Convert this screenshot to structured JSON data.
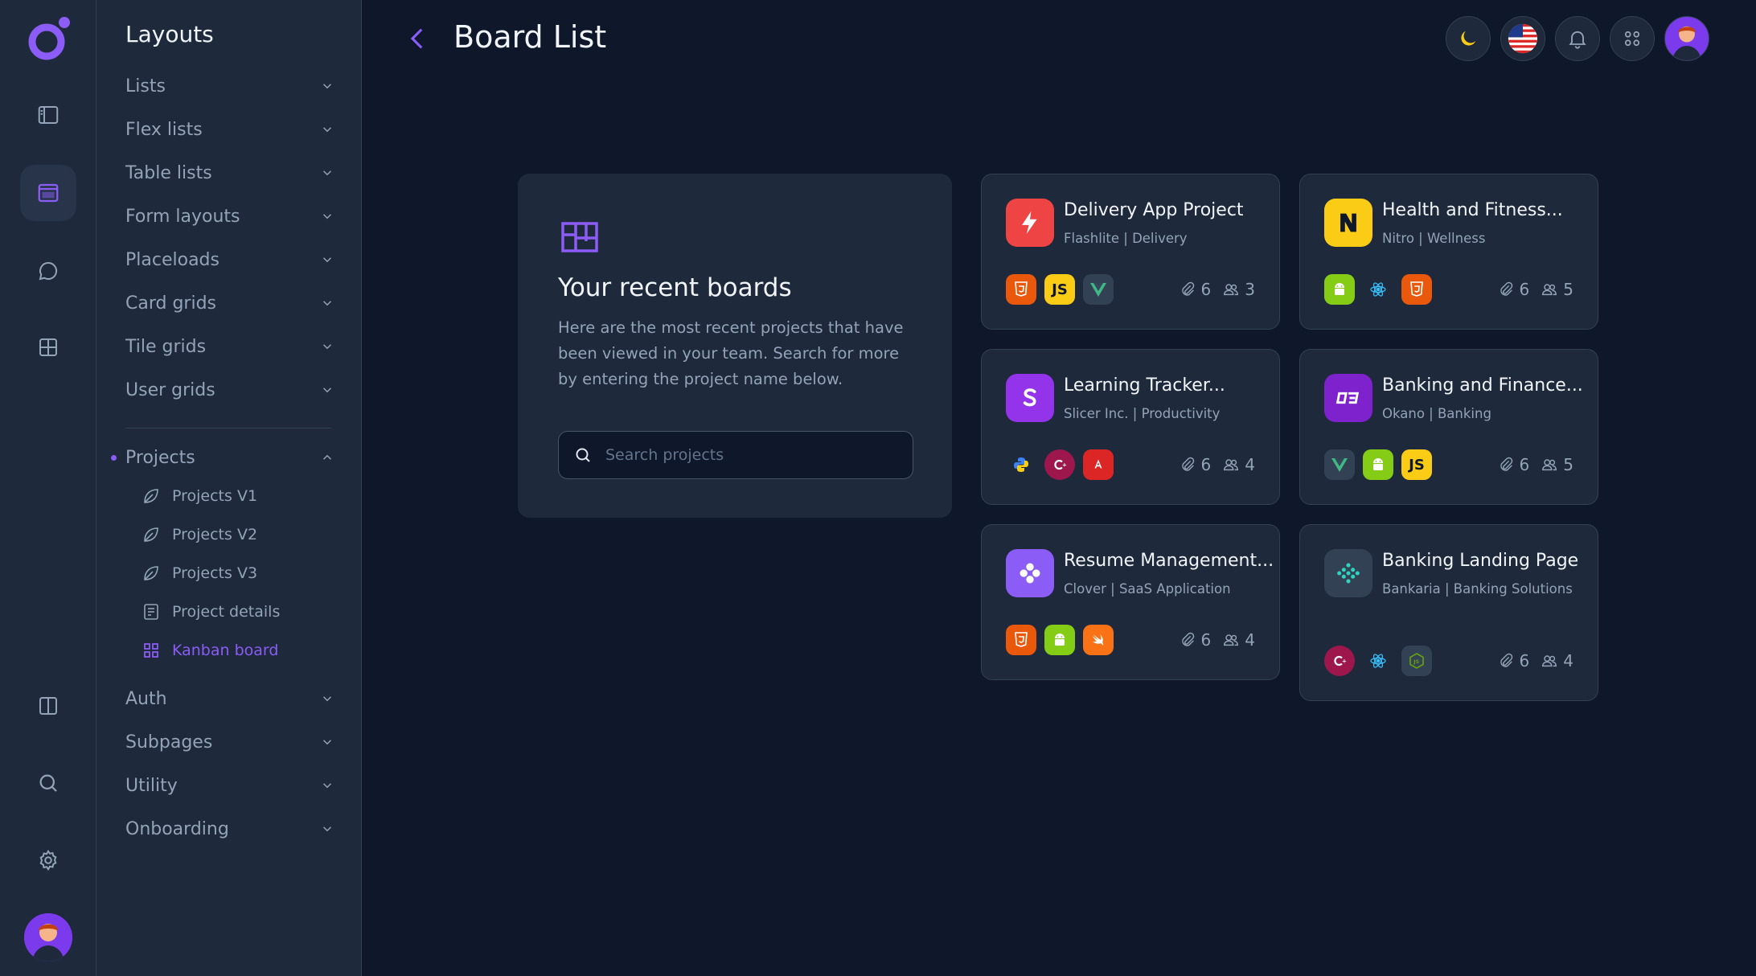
{
  "menu": {
    "title": "Layouts",
    "items": [
      {
        "label": "Lists"
      },
      {
        "label": "Flex lists"
      },
      {
        "label": "Table lists"
      },
      {
        "label": "Form layouts"
      },
      {
        "label": "Placeloads"
      },
      {
        "label": "Card grids"
      },
      {
        "label": "Tile grids"
      },
      {
        "label": "User grids"
      }
    ],
    "projects": {
      "label": "Projects",
      "children": [
        {
          "label": "Projects V1",
          "icon": "leaf-icon"
        },
        {
          "label": "Projects V2",
          "icon": "leaf-icon"
        },
        {
          "label": "Projects V3",
          "icon": "leaf-icon"
        },
        {
          "label": "Project details",
          "icon": "document-icon"
        },
        {
          "label": "Kanban board",
          "icon": "grid-icon",
          "active": true
        }
      ]
    },
    "bottom_items": [
      {
        "label": "Auth"
      },
      {
        "label": "Subpages"
      },
      {
        "label": "Utility"
      },
      {
        "label": "Onboarding"
      }
    ]
  },
  "header": {
    "title": "Board List"
  },
  "recent": {
    "title": "Your recent boards",
    "description": "Here are the most recent projects that have been viewed in your team. Search for more by entering the project name below.",
    "search_placeholder": "Search projects"
  },
  "projects": [
    {
      "title": "Delivery App Project",
      "subtitle": "Flashlite | Delivery",
      "attachments": "6",
      "members": "3",
      "logo_color": "#ef4444",
      "techs": [
        "html5",
        "js",
        "vue"
      ]
    },
    {
      "title": "Health and Fitness...",
      "subtitle": "Nitro | Wellness",
      "attachments": "6",
      "members": "5",
      "logo_color": "#facc15",
      "techs": [
        "android",
        "react",
        "html5"
      ]
    },
    {
      "title": "Learning Tracker...",
      "subtitle": "Slicer Inc. | Productivity",
      "attachments": "6",
      "members": "4",
      "logo_color": "#9333ea",
      "techs": [
        "python",
        "csharp",
        "angular"
      ]
    },
    {
      "title": "Banking and Finance...",
      "subtitle": "Okano | Banking",
      "attachments": "6",
      "members": "5",
      "logo_color": "#7e22ce",
      "techs": [
        "vue",
        "android",
        "js"
      ]
    },
    {
      "title": "Resume Management...",
      "subtitle": "Clover | SaaS Application",
      "attachments": "6",
      "members": "4",
      "logo_color": "#8b5cf6",
      "techs": [
        "html5",
        "android",
        "swift"
      ]
    },
    {
      "title": "Banking Landing Page",
      "subtitle": "Bankaria | Banking Solutions",
      "attachments": "6",
      "members": "4",
      "logo_color": "#334155",
      "techs": [
        "csharp",
        "react",
        "nodejs"
      ]
    }
  ],
  "colors": {
    "accent": "#8b5cf6",
    "background": "#0f172a",
    "panel": "#1e293b"
  }
}
